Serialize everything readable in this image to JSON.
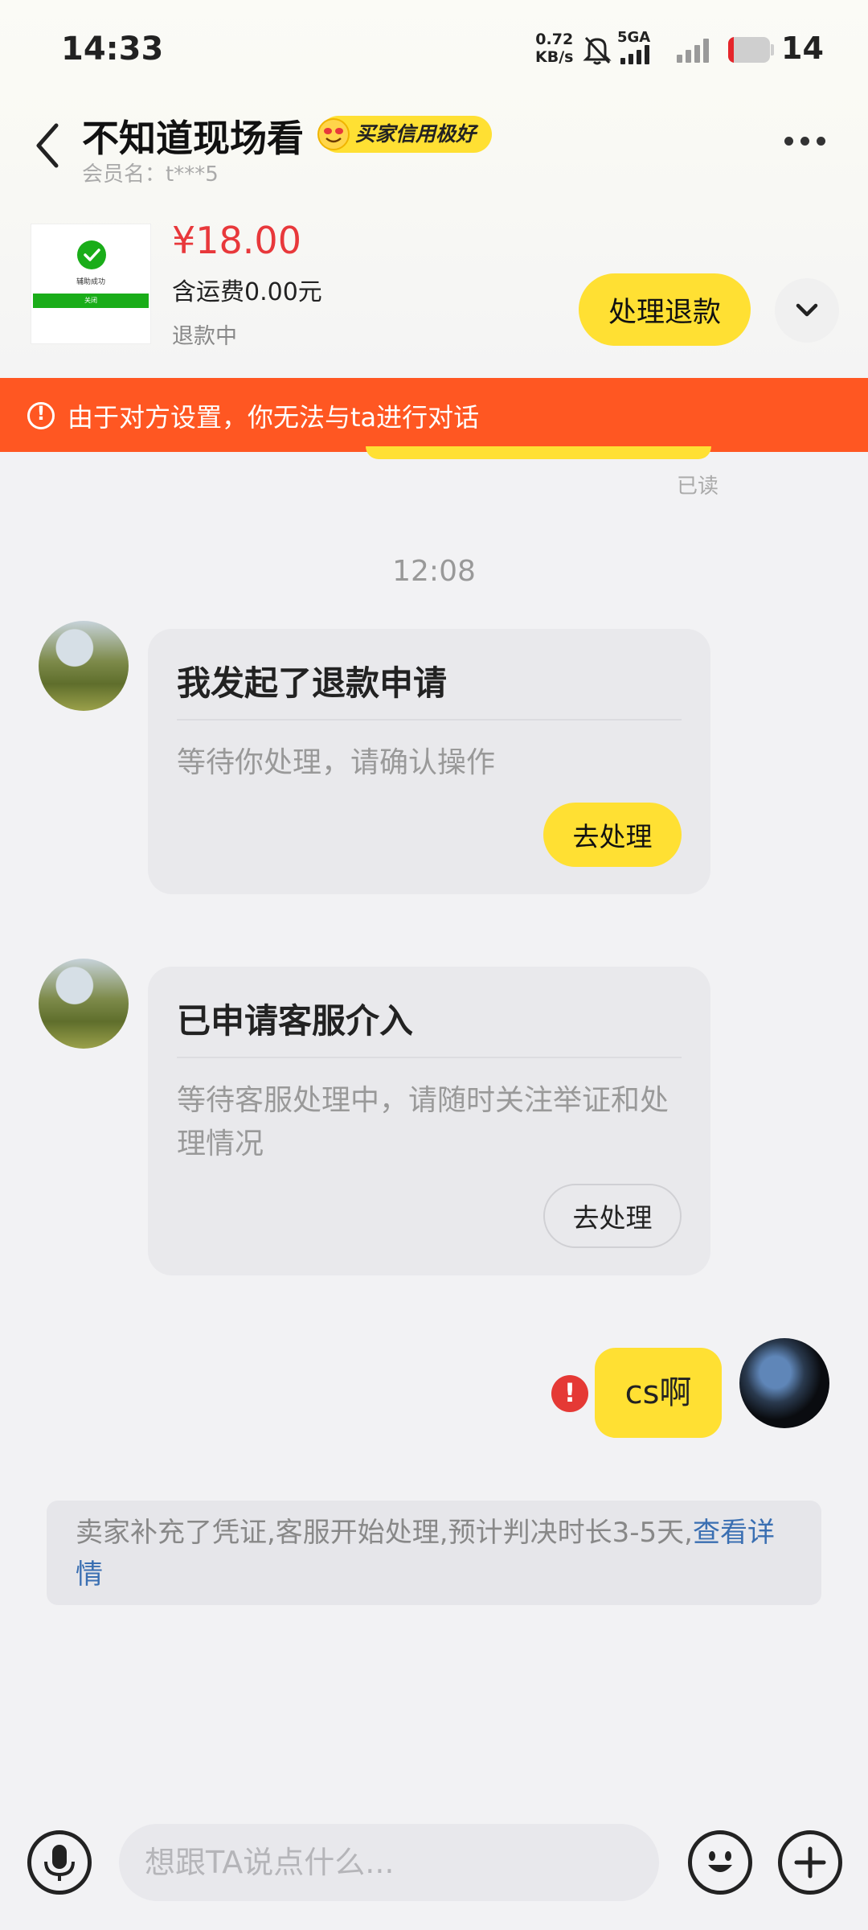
{
  "status_bar": {
    "time": "14:33",
    "net_speed_value": "0.72",
    "net_speed_unit": "KB/s",
    "network_type": "5GA",
    "battery_level": "14"
  },
  "header": {
    "contact_name": "不知道现场看",
    "credit_badge": "买家信用极好",
    "member_label": "会员名：t***5"
  },
  "order": {
    "price": "¥18.00",
    "shipping": "含运费0.00元",
    "status": "退款中",
    "refund_button": "处理退款",
    "thumbnail_text": "辅助成功",
    "thumbnail_button": "关闭"
  },
  "warning": {
    "text": "由于对方设置，你无法与ta进行对话"
  },
  "messages": {
    "read_label": "已读",
    "timestamp": "12:08",
    "card1": {
      "title": "我发起了退款申请",
      "desc": "等待你处理，请确认操作",
      "button": "去处理"
    },
    "card2": {
      "title": "已申请客服介入",
      "desc": "等待客服处理中，请随时关注举证和处理情况",
      "button": "去处理"
    },
    "my_message": "cs啊",
    "notice_text": "卖家补充了凭证,客服开始处理,预计判决时长3-5天,",
    "notice_link": "查看详情"
  },
  "input_bar": {
    "placeholder": "想跟TA说点什么..."
  },
  "colors": {
    "accent_yellow": "#ffe033",
    "warning_orange": "#ff5722",
    "price_red": "#e8383b",
    "link_blue": "#3a6fb2"
  }
}
